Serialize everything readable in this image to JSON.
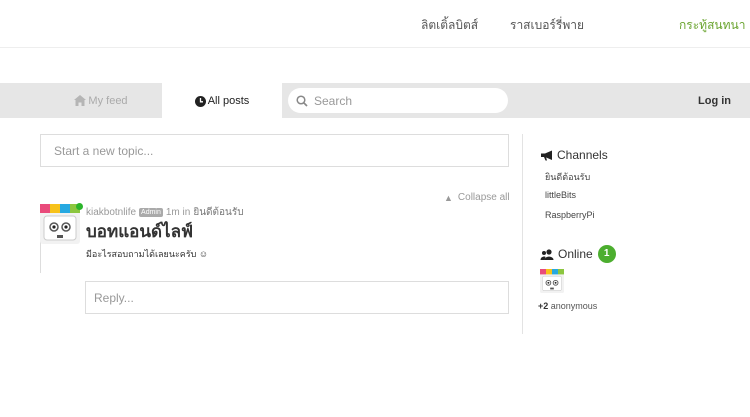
{
  "topnav": {
    "links": [
      "ลิตเติ้ลบิตส์",
      "ราสเบอร์รี่พาย",
      "กระทู้สนทนา"
    ]
  },
  "toolbar": {
    "tab_feed": "My feed",
    "tab_all": "All posts",
    "search_placeholder": "Search",
    "login": "Log in"
  },
  "composer": {
    "placeholder": "Start a new topic..."
  },
  "collapse_label": "Collapse all",
  "post": {
    "author": "kiakbotnlife",
    "role": "Admin",
    "time": "1m in",
    "channel": "ยินดีต้อนรับ",
    "title": "บอทแอนด์ไลฟ์",
    "body": "มีอะไรสอบถามได้เลยนะครับ ☺",
    "reply_placeholder": "Reply..."
  },
  "sidebar": {
    "channels_heading": "Channels",
    "channels": [
      "ยินดีต้อนรับ",
      "littleBits",
      "RaspberryPi"
    ],
    "online_heading": "Online",
    "online_count": "1",
    "anon_count": "+2",
    "anon_label": "anonymous"
  },
  "colors": {
    "accent": "#6aa42f",
    "online": "#4cae2f",
    "toolbar": "#e6e6e6"
  }
}
